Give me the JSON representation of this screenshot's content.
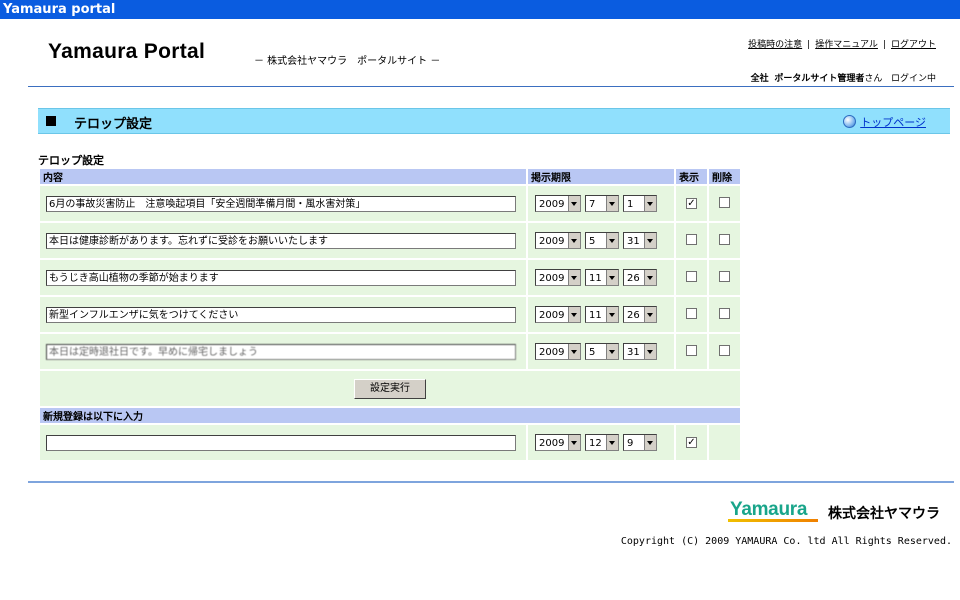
{
  "window": {
    "title": "Yamaura portal"
  },
  "header": {
    "site_title": "Yamaura Portal",
    "site_subtitle": "－ 株式会社ヤマウラ　ポータルサイト －",
    "links": [
      "投稿時の注意",
      "操作マニュアル",
      "ログアウト"
    ],
    "link_separator": "|",
    "user": {
      "org": "全社",
      "name": "ポータルサイト管理者",
      "suffix": "さん",
      "status": "ログイン中"
    }
  },
  "section": {
    "title": "テロップ設定",
    "top_link": "トップページ"
  },
  "form": {
    "title": "テロップ設定",
    "headers": {
      "content": "内容",
      "period": "掲示期限",
      "display": "表示",
      "delete": "削除"
    },
    "rows": [
      {
        "text": "6月の事故災害防止　注意喚起項目「安全週間準備月間・風水害対策」",
        "year": "2009",
        "month": "7",
        "day": "1",
        "display": true,
        "delete": false
      },
      {
        "text": "本日は健康診断があります。忘れずに受診をお願いいたします",
        "year": "2009",
        "month": "5",
        "day": "31",
        "display": false,
        "delete": false
      },
      {
        "text": "もうじき高山植物の季節が始まります",
        "year": "2009",
        "month": "11",
        "day": "26",
        "display": false,
        "delete": false
      },
      {
        "text": "新型インフルエンザに気をつけてください",
        "year": "2009",
        "month": "11",
        "day": "26",
        "display": false,
        "delete": false
      },
      {
        "text": "本日は定時退社日です。早めに帰宅しましょう",
        "year": "2009",
        "month": "5",
        "day": "31",
        "display": false,
        "delete": false
      }
    ],
    "submit_label": "設定実行",
    "new_header": "新規登録は以下に入力",
    "new_entry": {
      "text": "",
      "year": "2009",
      "month": "12",
      "day": "9",
      "display": true
    }
  },
  "footer": {
    "logo": "Yamaura",
    "company": "株式会社ヤマウラ",
    "copyright": "Copyright (C) 2009 YAMAURA Co. ltd All Rights Reserved."
  },
  "colors": {
    "titlebar": "#0a5ce0",
    "section_bar": "#90e0fd",
    "table_header": "#b9c7f3",
    "row_bg": "#e6f6e0",
    "logo": "#19a58a"
  }
}
